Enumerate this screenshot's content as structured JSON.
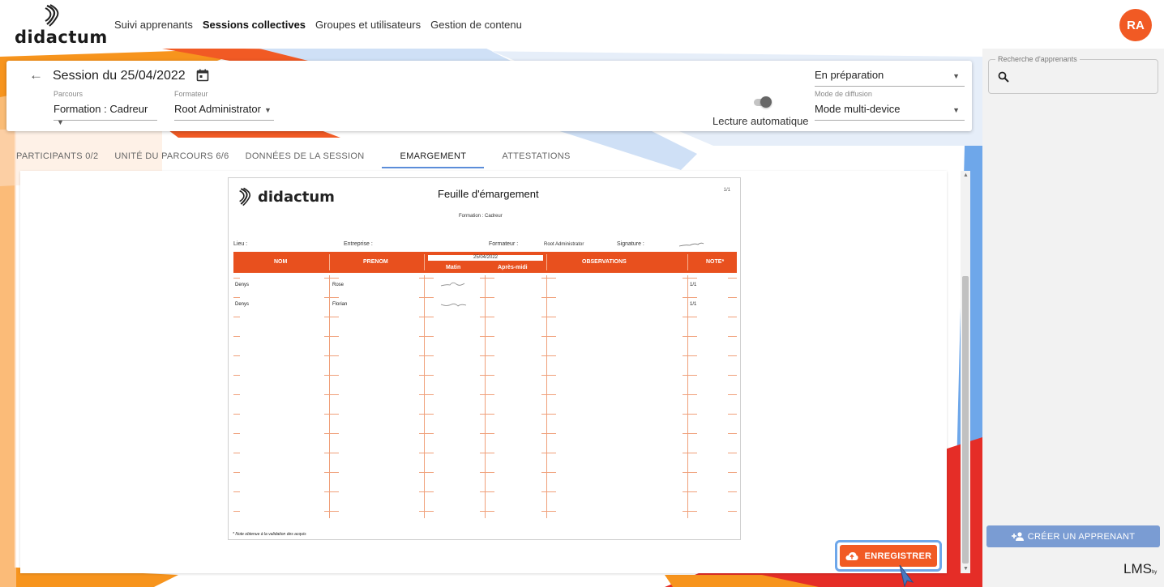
{
  "brand": {
    "name": "didactum"
  },
  "nav": {
    "items": [
      {
        "label": "Suivi apprenants",
        "active": false
      },
      {
        "label": "Sessions collectives",
        "active": true
      },
      {
        "label": "Groupes et utilisateurs",
        "active": false
      },
      {
        "label": "Gestion de contenu",
        "active": false
      }
    ]
  },
  "user": {
    "initials": "RA"
  },
  "session": {
    "title": "Session du 25/04/2022",
    "parcours_label": "Parcours",
    "parcours_value": "Formation : Cadreur",
    "formateur_label": "Formateur",
    "formateur_value": "Root Administrator",
    "auto_read_label": "Lecture automatique",
    "status_value": "En préparation",
    "diffusion_label": "Mode de diffusion",
    "diffusion_value": "Mode multi-device"
  },
  "tabs": [
    {
      "label": "PARTICIPANTS 0/2",
      "active": false
    },
    {
      "label": "UNITÉ DU PARCOURS 6/6",
      "active": false
    },
    {
      "label": "DONNÉES DE LA SESSION",
      "active": false
    },
    {
      "label": "EMARGEMENT",
      "active": true
    },
    {
      "label": "ATTESTATIONS",
      "active": false
    }
  ],
  "document": {
    "logo_text": "didactum",
    "title": "Feuille d'émargement",
    "page": "1/1",
    "formation": "Formation : Cadreur",
    "lieu_label": "Lieu :",
    "entreprise_label": "Entreprise :",
    "formateur_label": "Formateur :",
    "formateur_value": "Root Administrator",
    "signature_label": "Signature :",
    "columns": {
      "nom": "NOM",
      "prenom": "PRENOM",
      "date": "25/04/2022",
      "matin": "Matin",
      "apres_midi": "Après-midi",
      "observations": "OBSERVATIONS",
      "note": "NOTE*"
    },
    "rows": [
      {
        "nom": "Denys",
        "prenom": "Rose",
        "note": "1/1"
      },
      {
        "nom": "Denys",
        "prenom": "Florian",
        "note": "1/1"
      }
    ],
    "footnote": "* Note obtenue à la validation des acquis"
  },
  "actions": {
    "save_label": "ENREGISTRER"
  },
  "sidebar": {
    "search_label": "Recherche d'apprenants",
    "create_label": "CRÉER UN APPRENANT",
    "lms_label": "LMS",
    "lms_by": "by"
  },
  "colors": {
    "accent": "#f15a24",
    "tab_underline": "#5b8dd9",
    "create_button": "#7a9cd3",
    "deco_blue": "#6ea7ea",
    "deco_red": "#e52d27"
  }
}
